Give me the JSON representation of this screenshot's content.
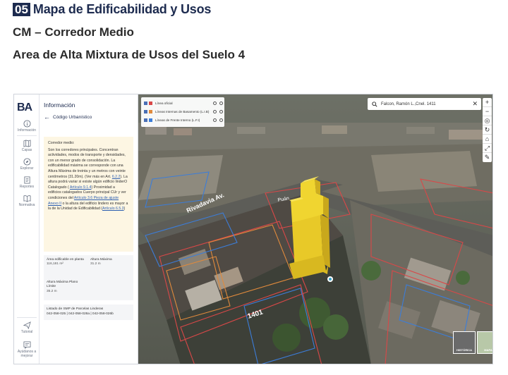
{
  "header": {
    "section_number": "05",
    "title": "Mapa de Edificabilidad y Usos",
    "subtitle": "CM – Corredor Medio",
    "subtitle2": "Area de Alta Mixtura de Usos del Suelo 4"
  },
  "app": {
    "logo": "BA",
    "rail": [
      {
        "label": "Información",
        "icon": "info-icon"
      },
      {
        "label": "Capas",
        "icon": "map-icon"
      },
      {
        "label": "Explorar",
        "icon": "compass-icon"
      },
      {
        "label": "Reportes",
        "icon": "report-icon"
      },
      {
        "label": "Normativa",
        "icon": "book-icon"
      },
      {
        "label": "Tutorial",
        "icon": "send-icon"
      },
      {
        "label": "Ayúdanos a mejorar",
        "icon": "feedback-icon"
      }
    ]
  },
  "panel": {
    "title": "Información",
    "back_label": "Código Urbanístico",
    "description": {
      "heading": "Corredor medio:",
      "text1": "Son los corredores principales. Concentran actividades, modos de transporte y densidades, con un menor grado de consolidación. La edificabilidad máxima se corresponde con una Altura Máxima de treinta y un metros con veinte centímetros (31.20m). (Ver más en Art.",
      "link1": "6.2.2",
      "text2": "). La altura podrá variar si existe algún edificio linderO Catalogado (",
      "link2": "Artículo 9.1.4",
      "text3": ") Proximidad a edificios catalogados Cuerpo principal CUr y ver condiciones del",
      "link3": "Artículo 3.6 Pieza de ajuste Anexo II",
      "text4": "o la altura del edificio lindero es mayor a la de la Unidad de Edificabilidad (",
      "link4": "Artículo 6.5.3",
      "text5": ")"
    },
    "stats": [
      {
        "label": "Área edificable en planta",
        "value": "116,181 m²"
      },
      {
        "label": "Altura Máxima",
        "value": "31.2 m"
      },
      {
        "label": "Altura Máxima Plano Límite",
        "value": "35.2 m"
      }
    ],
    "smp": {
      "label": "Listado de SMP de Parcelas Linderas",
      "value": "042-058-025 | 042-058-028a | 042-058-026b"
    }
  },
  "map": {
    "layers": [
      {
        "label": "Línea oficial",
        "color": "#d94848"
      },
      {
        "label": "Líneas Internas de Basamento (L.I.B)",
        "color": "#e08a3c"
      },
      {
        "label": "Líneas de Frente Interno (L.F.I)",
        "color": "#3c7dd9"
      }
    ],
    "search_value": "Falcon, Ramón L.,Cnel. 1411",
    "zoom_in": "+",
    "zoom_out": "−",
    "street_labels": [
      "Rivadavia Av.",
      "Puán",
      "1401"
    ],
    "basemaps": [
      {
        "label": "HISTÓRICA"
      },
      {
        "label": "MAPA"
      }
    ]
  }
}
